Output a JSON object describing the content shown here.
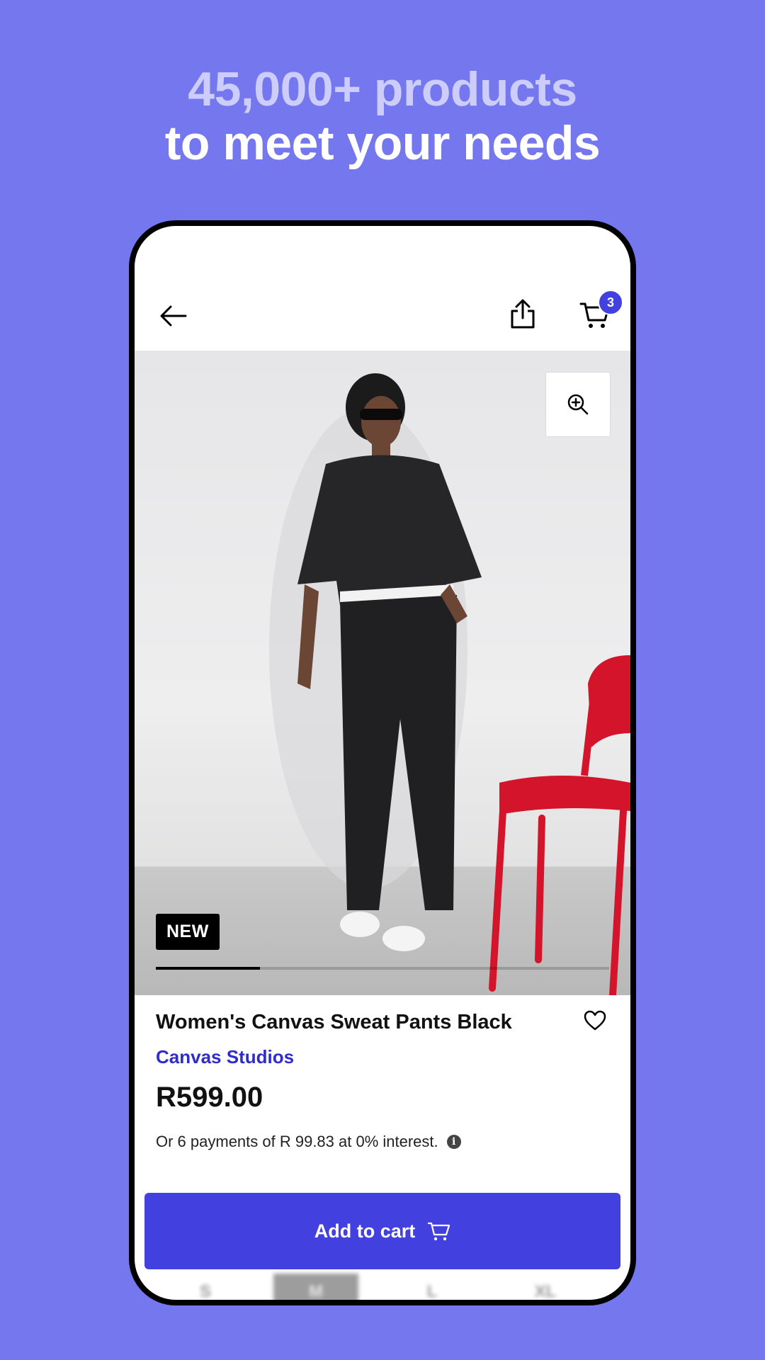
{
  "headline": {
    "line1": "45,000+ products",
    "line2": "to meet your needs"
  },
  "topbar": {
    "back_icon": "arrow-left-icon",
    "share_icon": "share-icon",
    "cart_icon": "cart-icon",
    "cart_count": "3"
  },
  "hero": {
    "zoom_icon": "zoom-in-icon",
    "tag": "NEW",
    "gallery_progress": 0.23
  },
  "product": {
    "title": "Women's Canvas Sweat Pants Black",
    "brand": "Canvas Studios",
    "price": "R599.00",
    "installments": "Or 6 payments of R 99.83 at 0% interest.",
    "info_icon": "i"
  },
  "actions": {
    "add_to_cart": "Add to cart"
  },
  "sizes": {
    "options": [
      "S",
      "M",
      "L",
      "XL"
    ],
    "selected": "M"
  },
  "colors": {
    "background": "#7577ee",
    "accent": "#4340e0",
    "brand": "#2f2cc9",
    "chair": "#d3142a"
  }
}
